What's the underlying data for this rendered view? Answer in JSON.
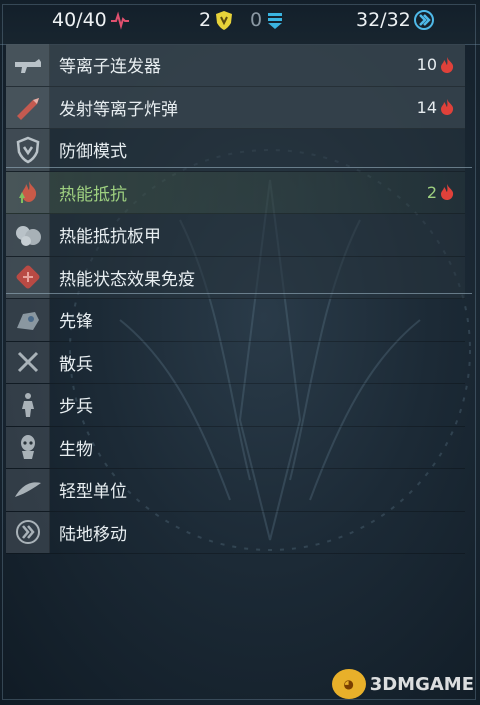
{
  "stats": {
    "health": "40/40",
    "shield": "2",
    "armor": "0",
    "movement": "32/32"
  },
  "weapons": [
    {
      "name": "等离子连发器",
      "value": "10",
      "icon": "plasma-gun-icon"
    },
    {
      "name": "发射等离子炸弹",
      "value": "14",
      "icon": "plasma-bomb-icon"
    }
  ],
  "abilities": [
    {
      "name": "防御模式",
      "icon": "shield-mode-icon"
    },
    {
      "name": "热能抵抗",
      "value": "2",
      "icon": "thermal-resist-icon",
      "selected": true
    },
    {
      "name": "热能抵抗板甲",
      "icon": "thermal-armor-icon"
    },
    {
      "name": "热能状态效果免疫",
      "icon": "thermal-immunity-icon"
    }
  ],
  "tags": [
    {
      "name": "先锋",
      "icon": "vanguard-icon"
    },
    {
      "name": "散兵",
      "icon": "skirmisher-icon"
    },
    {
      "name": "步兵",
      "icon": "infantry-icon"
    },
    {
      "name": "生物",
      "icon": "organic-icon"
    },
    {
      "name": "轻型单位",
      "icon": "light-unit-icon"
    },
    {
      "name": "陆地移动",
      "icon": "land-movement-icon"
    }
  ],
  "watermark": "3DMGAME",
  "colors": {
    "selected_text": "#9ed080",
    "heat_icon": "#e0413a",
    "shield_icon": "#e8d33a",
    "armor_icon": "#3ab4e0",
    "health_icon": "#e0506e",
    "move_icon": "#4fb9e8"
  }
}
